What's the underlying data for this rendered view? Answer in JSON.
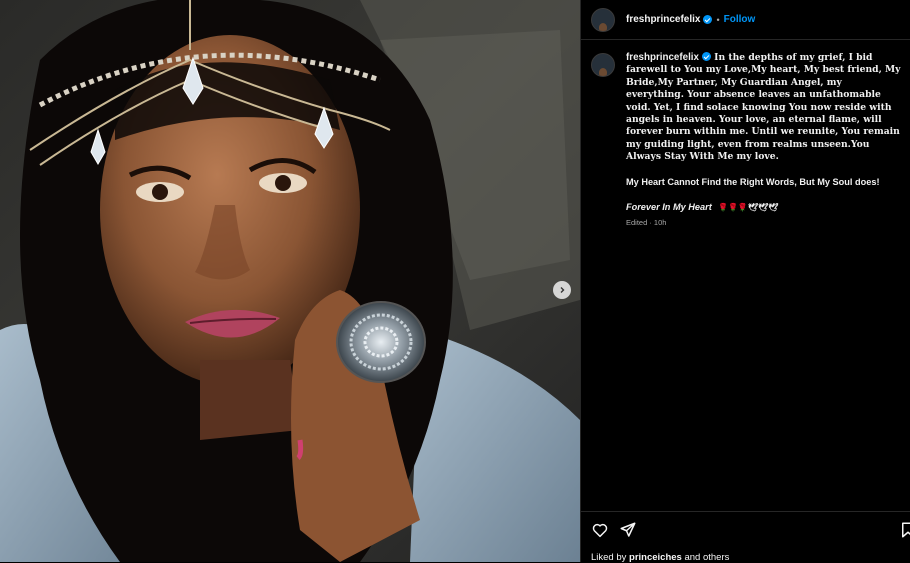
{
  "post": {
    "username": "freshprincefelix",
    "separator": "•",
    "follow_label": "Follow",
    "caption_lines": [
      "In the depths of my grief, I bid farewell to You my Love,My heart, My best friend, My Bride,My Partner, My Guardian Angel, my everything. Your absence leaves an unfathomable void. Yet, I find solace knowing You now reside with angels in heaven. Your love, an eternal flame, will forever burn within me. Until we reunite, You remain my guiding light, even from realms unseen.You Always Stay With Me my love.",
      "My Heart Cannot Find the Right Words, But My Soul does!",
      "Forever In My Heart"
    ],
    "caption_emoji": "🌹🌹🌹🕊🕊🕊",
    "edited_label": "Edited · 10h",
    "likes_prefix": "Liked by",
    "likes_user": "princeiches",
    "likes_suffix": "and others"
  },
  "icons": {
    "verified": "verified-badge-icon",
    "next": "chevron-right-icon",
    "like": "heart-icon",
    "share": "paper-plane-icon",
    "save": "bookmark-icon"
  },
  "colors": {
    "accent": "#0095f6",
    "background": "#000000",
    "divider": "#262626"
  }
}
